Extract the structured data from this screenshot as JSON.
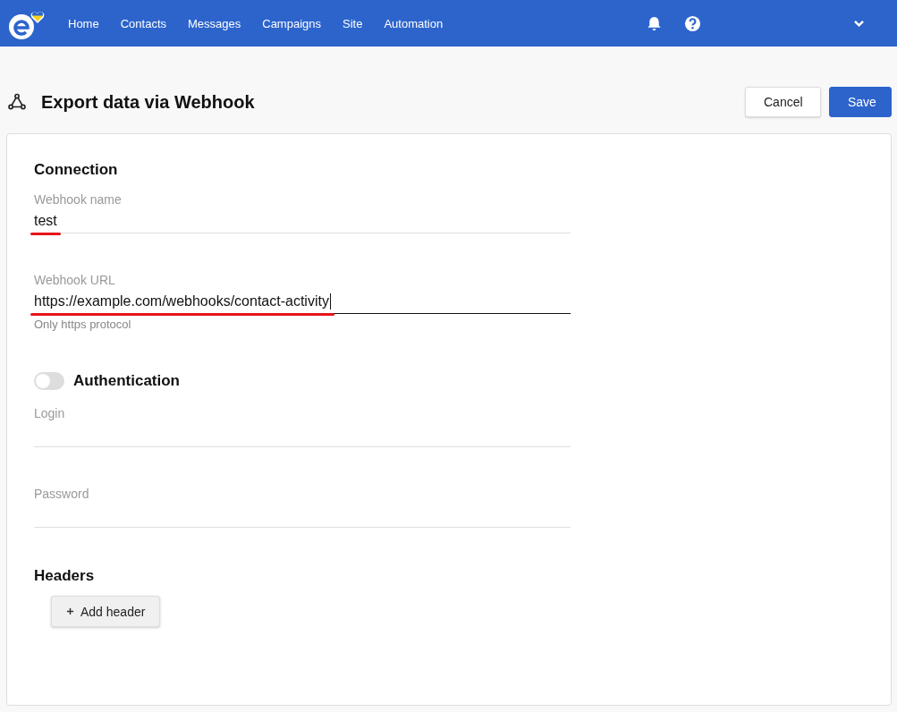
{
  "nav": {
    "items": [
      {
        "label": "Home"
      },
      {
        "label": "Contacts"
      },
      {
        "label": "Messages"
      },
      {
        "label": "Campaigns"
      },
      {
        "label": "Site"
      },
      {
        "label": "Automation"
      }
    ]
  },
  "page": {
    "title": "Export data via Webhook",
    "buttons": [
      {
        "label": "Cancel",
        "kind": "secondary"
      },
      {
        "label": "Save",
        "kind": "primary"
      }
    ]
  },
  "connection": {
    "heading": "Connection",
    "fields": [
      {
        "label": "Webhook name",
        "value": "test",
        "focused": false,
        "highlighted": true
      },
      {
        "label": "Webhook URL",
        "value": "https://example.com/webhooks/contact-activity",
        "focused": true,
        "highlighted": true,
        "hint": "Only https protocol"
      }
    ]
  },
  "authentication": {
    "label": "Authentication",
    "on": false,
    "fields": [
      {
        "label": "Login",
        "focused": false,
        "highlighted": false
      },
      {
        "label": "Password",
        "focused": false,
        "highlighted": false
      }
    ]
  },
  "headers": {
    "heading": "Headers",
    "button": "Add header"
  }
}
